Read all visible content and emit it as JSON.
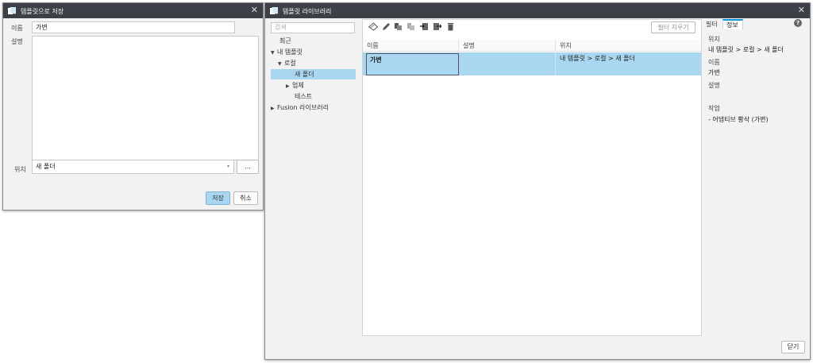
{
  "save_dialog": {
    "title": "템플릿으로 저장",
    "name_label": "이름",
    "name_value": "가변",
    "description_label": "설명",
    "description_value": "",
    "location_label": "위치",
    "location_value": "새 폴더",
    "browse_label": "...",
    "save_label": "저장",
    "cancel_label": "취소"
  },
  "library": {
    "title": "템플릿 라이브러리",
    "search_placeholder": "검색",
    "tree": {
      "recent": "최근",
      "my_templates": "내 템플릿",
      "local": "로컬",
      "new_folder": "새 폴더",
      "upload": "업체",
      "test": "테스트",
      "fusion_library": "Fusion 라이브러리"
    },
    "clear_filter_label": "필터 지우기",
    "columns": {
      "name": "이름",
      "description": "설명",
      "location": "위치"
    },
    "rows": [
      {
        "name": "가변",
        "description": "",
        "location": "내 템플릿 > 로컬 > 새 폴더"
      }
    ],
    "tabs": {
      "filter": "필터",
      "info": "정보"
    },
    "help_icon": "help-icon",
    "info": {
      "location_label": "위치",
      "location_value": "내 템플릿 > 로컬 > 새 폴더",
      "name_label": "이름",
      "name_value": "가변",
      "description_label": "설명",
      "description_value": "",
      "operations_label": "작업",
      "operations_value": "- 어댑티브 황삭 (가변)"
    },
    "close_label": "닫기"
  },
  "colors": {
    "titlebar": "#3d4147",
    "selection": "#a9d6f0",
    "accent": "#0696d7"
  }
}
